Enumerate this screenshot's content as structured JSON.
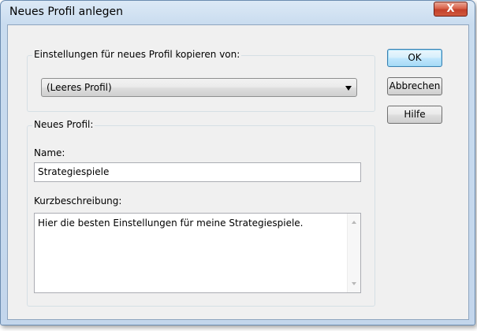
{
  "window": {
    "title": "Neues Profil anlegen",
    "close_glyph": "X"
  },
  "copy_group": {
    "label": "Einstellungen für neues Profil kopieren von:",
    "selected": "(Leeres Profil)"
  },
  "new_profile_group": {
    "label": "Neues Profil:",
    "name_label": "Name:",
    "name_value": "Strategiespiele",
    "desc_label": "Kurzbeschreibung:",
    "desc_value": "Hier die besten Einstellungen für meine Strategiespiele."
  },
  "buttons": {
    "ok": "OK",
    "cancel": "Abbrechen",
    "help": "Hilfe"
  }
}
